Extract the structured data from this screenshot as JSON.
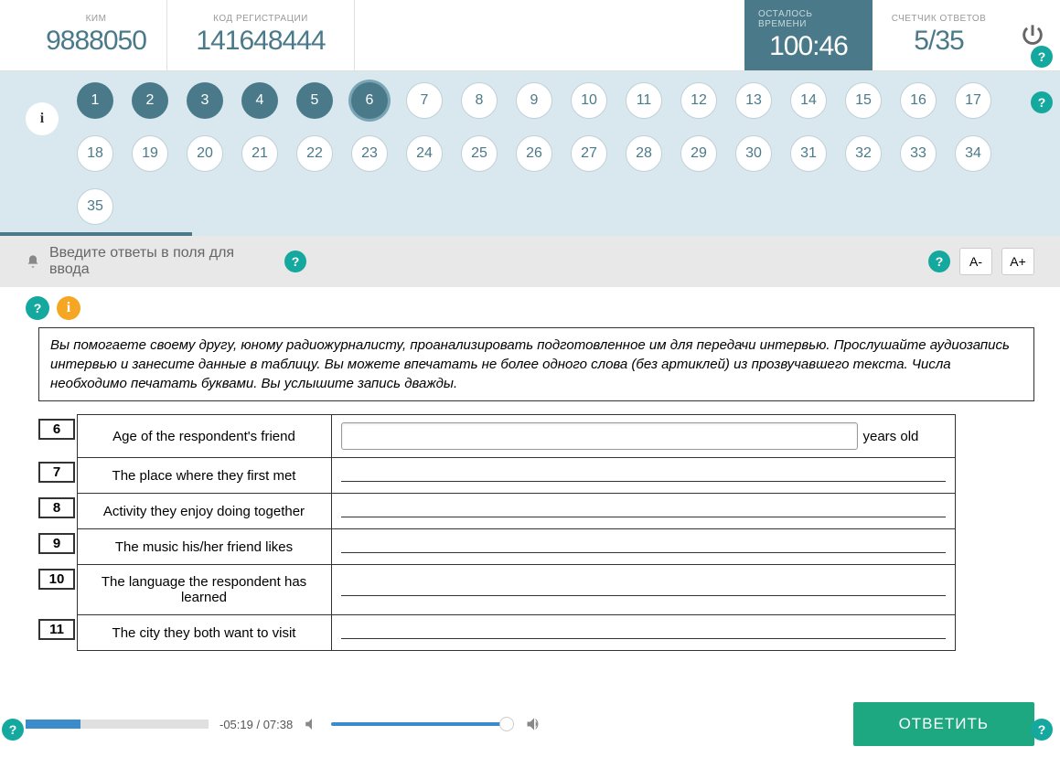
{
  "header": {
    "kim_label": "КИМ",
    "kim_value": "9888050",
    "reg_label": "КОД РЕГИСТРАЦИИ",
    "reg_value": "141648444",
    "time_label": "ОСТАЛОСЬ ВРЕМЕНИ",
    "time_value": "100:46",
    "answers_label": "СЧЕТЧИК ОТВЕТОВ",
    "answers_value": "5/35"
  },
  "nav": {
    "info": "i",
    "items": [
      {
        "n": "1",
        "state": "done"
      },
      {
        "n": "2",
        "state": "done"
      },
      {
        "n": "3",
        "state": "done"
      },
      {
        "n": "4",
        "state": "done"
      },
      {
        "n": "5",
        "state": "done"
      },
      {
        "n": "6",
        "state": "current"
      },
      {
        "n": "7",
        "state": ""
      },
      {
        "n": "8",
        "state": ""
      },
      {
        "n": "9",
        "state": ""
      },
      {
        "n": "10",
        "state": ""
      },
      {
        "n": "11",
        "state": ""
      },
      {
        "n": "12",
        "state": ""
      },
      {
        "n": "13",
        "state": ""
      },
      {
        "n": "14",
        "state": ""
      },
      {
        "n": "15",
        "state": ""
      },
      {
        "n": "16",
        "state": ""
      },
      {
        "n": "17",
        "state": ""
      },
      {
        "n": "18",
        "state": ""
      },
      {
        "n": "19",
        "state": ""
      },
      {
        "n": "20",
        "state": ""
      },
      {
        "n": "21",
        "state": ""
      },
      {
        "n": "22",
        "state": ""
      },
      {
        "n": "23",
        "state": ""
      },
      {
        "n": "24",
        "state": ""
      },
      {
        "n": "25",
        "state": ""
      },
      {
        "n": "26",
        "state": ""
      },
      {
        "n": "27",
        "state": ""
      },
      {
        "n": "28",
        "state": ""
      },
      {
        "n": "29",
        "state": ""
      },
      {
        "n": "30",
        "state": ""
      },
      {
        "n": "31",
        "state": ""
      },
      {
        "n": "32",
        "state": ""
      },
      {
        "n": "33",
        "state": ""
      },
      {
        "n": "34",
        "state": ""
      },
      {
        "n": "35",
        "state": ""
      }
    ]
  },
  "prompt": {
    "text": "Введите ответы в поля для ввода",
    "help": "?",
    "font_minus": "A-",
    "font_plus": "A+"
  },
  "icons": {
    "help": "?",
    "info": "i"
  },
  "instruction": "Вы помогаете своему другу, юному радиожурналисту, проанализировать подготовленное им для передачи интервью. Прослушайте аудиозапись интервью и занесите данные в таблицу. Вы можете впечатать не более одного слова (без артиклей) из прозвучавшего текста. Числа необходимо печатать буквами. Вы услышите запись дважды.",
  "rows": [
    {
      "num": "6",
      "label": "Age of the respondent's friend",
      "suffix": "years old",
      "input": true
    },
    {
      "num": "7",
      "label": "The place where they first met",
      "suffix": "",
      "input": false
    },
    {
      "num": "8",
      "label": "Activity they enjoy doing together",
      "suffix": "",
      "input": false
    },
    {
      "num": "9",
      "label": "The music his/her friend likes",
      "suffix": "",
      "input": false
    },
    {
      "num": "10",
      "label": "The language the respondent has learned",
      "suffix": "",
      "input": false
    },
    {
      "num": "11",
      "label": "The city they both want to visit",
      "suffix": "",
      "input": false
    }
  ],
  "footer": {
    "time": "-05:19 / 07:38",
    "answer_btn": "ОТВЕТИТЬ"
  }
}
